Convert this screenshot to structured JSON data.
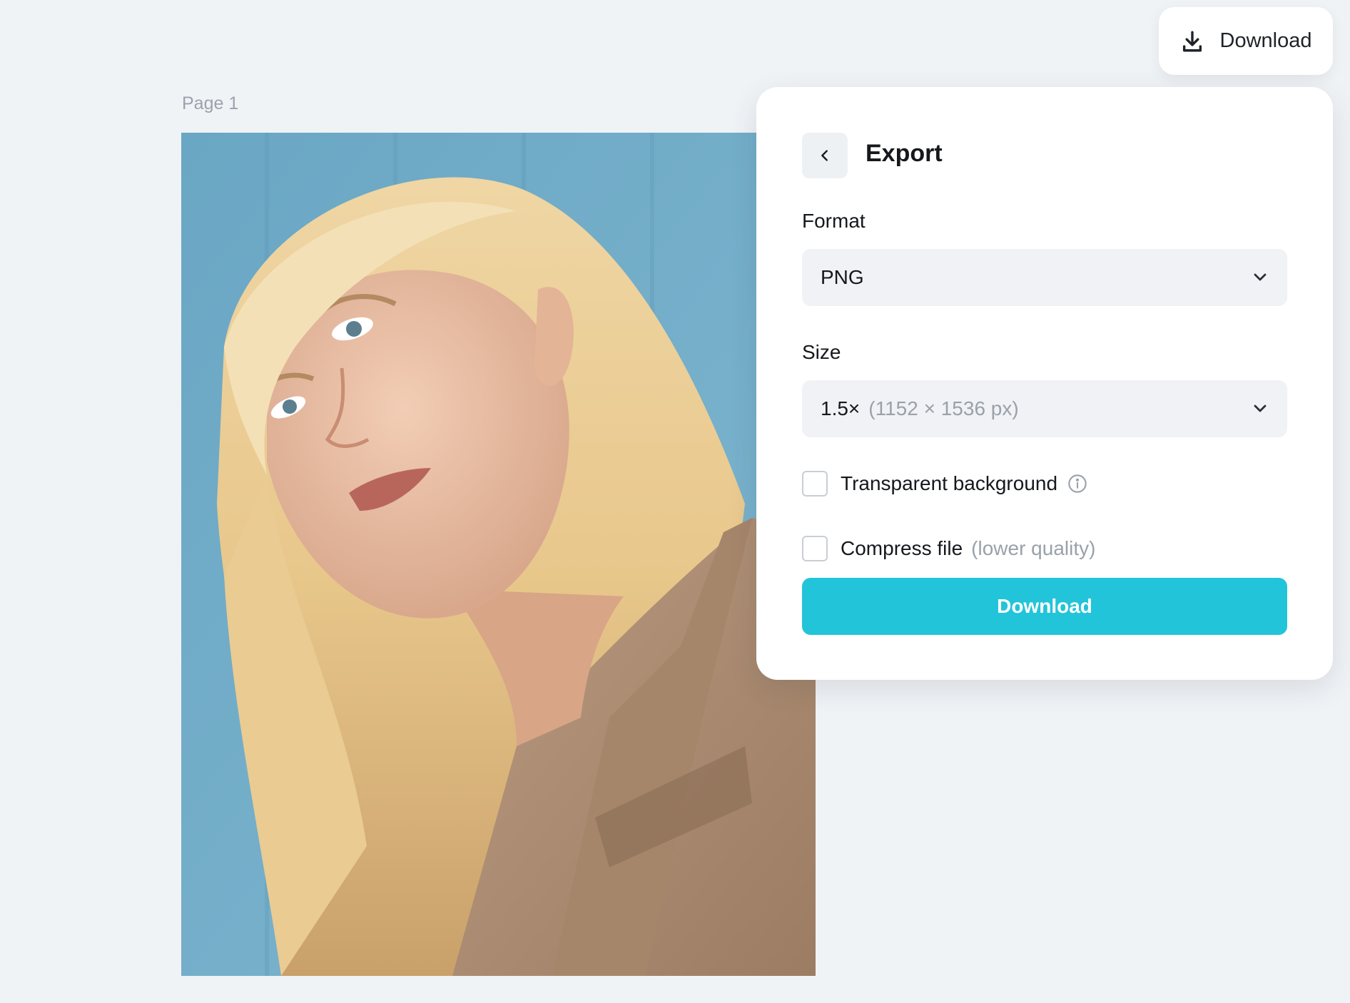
{
  "canvas": {
    "page_label": "Page 1",
    "image_alt": "portrait photo"
  },
  "toolbar": {
    "download_label": "Download",
    "download_icon": "download-icon"
  },
  "export_panel": {
    "title": "Export",
    "back_icon": "chevron-left-icon",
    "format": {
      "label": "Format",
      "selected": "PNG"
    },
    "size": {
      "label": "Size",
      "selected": "1.5×",
      "dimensions": "(1152 × 1536 px)"
    },
    "transparent_background": {
      "label": "Transparent background",
      "checked": false,
      "icon": "info-icon"
    },
    "compress_file": {
      "label": "Compress file",
      "hint": "(lower quality)",
      "checked": false
    },
    "download_button_label": "Download"
  },
  "colors": {
    "background": "#f0f3f6",
    "accent": "#22c4d9",
    "panel": "#ffffff"
  }
}
